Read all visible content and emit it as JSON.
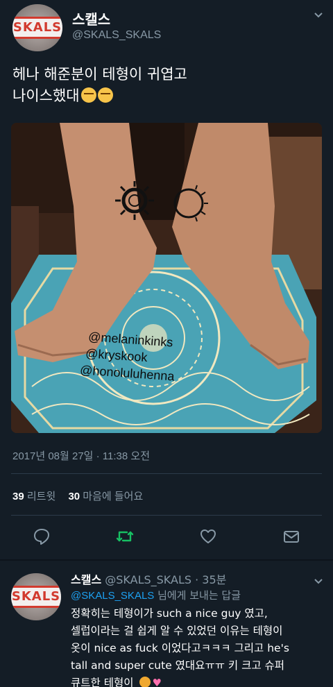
{
  "tweet": {
    "author_name": "스캘스",
    "author_handle": "@SKALS_SKALS",
    "avatar_logo": "SKALS",
    "text_line1": "헤나 해준분이 테형이 귀엽고",
    "text_line2": "나이스했대",
    "emoji": [
      "face-with-tears-of-joy",
      "face-with-tears-of-joy"
    ],
    "photo": {
      "watermarks": [
        "@melaninkinks",
        "@kryskook",
        "@honoluluhenna"
      ]
    },
    "timestamp": "2017년 08월 27일 · 11:38 오전",
    "retweets_count": "39",
    "retweets_label": "리트윗",
    "likes_count": "30",
    "likes_label": "마음에 들어요"
  },
  "actions": {
    "reply": "reply-icon",
    "retweet": "retweet-icon",
    "like": "heart-icon",
    "share": "share-icon"
  },
  "reply": {
    "author_name": "스캘스",
    "meta": "@SKALS_SKALS · 35분",
    "avatar_logo": "SKALS",
    "reply_to_handle": "@SKALS_SKALS",
    "reply_to_suffix": "님에게 보내는 답글",
    "body_line1": "정확히는 테형이가 such a nice guy 였고,",
    "body_line2": "셀럽이라는 걸 쉽게 알 수 있었던 이유는 테형이",
    "body_line3": "옷이 nice as fuck 이었다고ㅋㅋㅋ 그리고 he's",
    "body_line4": "tall and super cute 였대요ㅠㅠ 키 크고 슈퍼",
    "body_line5": "큐트한 테형이"
  },
  "colors": {
    "background": "#141d26",
    "secondary_text": "#8899a6",
    "link": "#1da1f2",
    "retweet_accent": "#17bf63",
    "brand_red": "#d23a2e"
  }
}
